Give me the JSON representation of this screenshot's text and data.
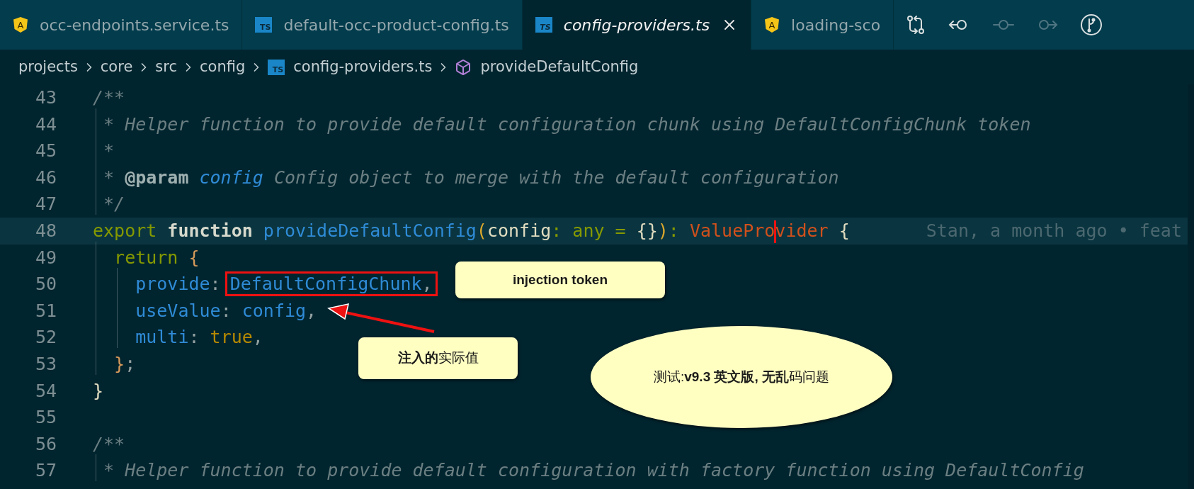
{
  "tabs": [
    {
      "label": "occ-endpoints.service.ts",
      "kind": "angular",
      "badge": "A",
      "selected": false,
      "preview": false
    },
    {
      "label": "default-occ-product-config.ts",
      "kind": "ts",
      "badge": "TS",
      "selected": false,
      "preview": false
    },
    {
      "label": "config-providers.ts",
      "kind": "ts",
      "badge": "TS",
      "selected": true,
      "preview": true
    },
    {
      "label": "loading-sco",
      "kind": "angular",
      "badge": "A",
      "selected": false,
      "preview": false
    }
  ],
  "toolbar": [
    {
      "kind": "compare",
      "disabled": false
    },
    {
      "kind": "back",
      "disabled": false
    },
    {
      "kind": "dot",
      "disabled": true
    },
    {
      "kind": "forward",
      "disabled": true
    },
    {
      "kind": "branch",
      "disabled": false
    }
  ],
  "breadcrumb": [
    {
      "label": "projects",
      "kind": "folder"
    },
    {
      "label": "core",
      "kind": "folder"
    },
    {
      "label": "src",
      "kind": "folder"
    },
    {
      "label": "config",
      "kind": "folder"
    },
    {
      "label": "config-providers.ts",
      "kind": "file",
      "badge": "TS"
    },
    {
      "label": "provideDefaultConfig",
      "kind": "symbol"
    }
  ],
  "editor": {
    "lines": [
      {
        "number": "43",
        "current": false,
        "tokens": [
          {
            "text": "/**",
            "kind": "comment"
          }
        ]
      },
      {
        "number": "44",
        "current": false,
        "tokens": [
          {
            "text": " * Helper function to provide default configuration chunk using DefaultConfigChunk token",
            "kind": "comment"
          }
        ]
      },
      {
        "number": "45",
        "current": false,
        "tokens": [
          {
            "text": " *",
            "kind": "comment"
          }
        ]
      },
      {
        "number": "46",
        "current": false,
        "tokens": [
          {
            "text": " * ",
            "kind": "comment"
          },
          {
            "text": "@param ",
            "kind": "doctag"
          },
          {
            "text": "config",
            "kind": "docparam"
          },
          {
            "text": " Config object to merge with the default configuration",
            "kind": "comment"
          }
        ]
      },
      {
        "number": "47",
        "current": false,
        "tokens": [
          {
            "text": " */",
            "kind": "comment"
          }
        ]
      },
      {
        "number": "48",
        "current": true,
        "blame": "Stan, a month ago • feat",
        "tokens": [
          {
            "text": "export ",
            "kind": "keyword"
          },
          {
            "text": "function",
            "kind": "storage"
          },
          {
            "text": " provideDefaultConfig",
            "kind": "function"
          },
          {
            "text": "(",
            "kind": "paren"
          },
          {
            "text": "config",
            "kind": "plain"
          },
          {
            "text": ": any = ",
            "kind": "keyword"
          },
          {
            "text": "{}",
            "kind": "plain"
          },
          {
            "text": ")",
            "kind": "paren"
          },
          {
            "text": ": ",
            "kind": "keyword"
          },
          {
            "text": "ValuePro",
            "kind": "type",
            "cursor": true
          },
          {
            "text": "vider",
            "kind": "type"
          },
          {
            "text": " {",
            "kind": "plain"
          }
        ]
      },
      {
        "number": "49",
        "current": false,
        "tokens": [
          {
            "text": "  return",
            "kind": "keyword"
          },
          {
            "text": " {",
            "kind": "brace"
          }
        ]
      },
      {
        "number": "50",
        "current": false,
        "tokens": [
          {
            "text": "    provide",
            "kind": "property"
          },
          {
            "text": ":",
            "kind": "punct"
          },
          {
            "boxed": true,
            "tokens": [
              {
                "text": "DefaultConfigChunk",
                "kind": "property"
              },
              {
                "text": ",",
                "kind": "punct"
              }
            ]
          }
        ]
      },
      {
        "number": "51",
        "current": false,
        "tokens": [
          {
            "text": "    useValue",
            "kind": "property"
          },
          {
            "text": ": ",
            "kind": "punct"
          },
          {
            "text": "config",
            "kind": "property"
          },
          {
            "text": ",",
            "kind": "punct"
          }
        ]
      },
      {
        "number": "52",
        "current": false,
        "tokens": [
          {
            "text": "    multi",
            "kind": "property"
          },
          {
            "text": ": ",
            "kind": "punct"
          },
          {
            "text": "true",
            "kind": "constant"
          },
          {
            "text": ",",
            "kind": "punct"
          }
        ]
      },
      {
        "number": "53",
        "current": false,
        "tokens": [
          {
            "text": "  }",
            "kind": "brace"
          },
          {
            "text": ";",
            "kind": "punct"
          }
        ]
      },
      {
        "number": "54",
        "current": false,
        "tokens": [
          {
            "text": "}",
            "kind": "plain"
          }
        ]
      },
      {
        "number": "55",
        "current": false
      },
      {
        "number": "56",
        "current": false,
        "tokens": [
          {
            "text": "/**",
            "kind": "comment"
          }
        ]
      },
      {
        "number": "57",
        "current": false,
        "tokens": [
          {
            "text": " * Helper function to provide default configuration with factory function using DefaultConfig",
            "kind": "comment"
          }
        ]
      }
    ]
  },
  "callouts": [
    {
      "kind": "rect",
      "text": "injection token"
    },
    {
      "kind": "rect",
      "text": "**注入的**实际值"
    },
    {
      "kind": "ellipse",
      "text": "测试:**v9.3 英文版, 无乱**码问题"
    }
  ]
}
